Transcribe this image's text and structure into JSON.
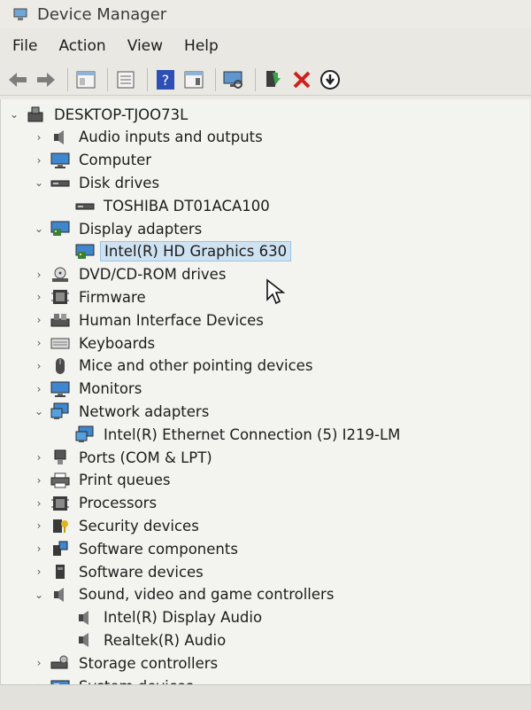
{
  "window": {
    "title": "Device Manager"
  },
  "menu": {
    "file": "File",
    "action": "Action",
    "view": "View",
    "help": "Help"
  },
  "toolbar": {
    "icons": [
      "back-arrow-icon",
      "forward-arrow-icon",
      "properties-icon",
      "list-icon",
      "help-icon",
      "view-icon",
      "scan-hardware-icon",
      "update-driver-icon",
      "uninstall-icon",
      "download-icon"
    ]
  },
  "tree": {
    "root": "DESKTOP-TJOO73L",
    "nodes": [
      {
        "label": "Audio inputs and outputs",
        "expanded": false
      },
      {
        "label": "Computer",
        "expanded": false
      },
      {
        "label": "Disk drives",
        "expanded": true
      },
      {
        "label": "TOSHIBA DT01ACA100",
        "child": true
      },
      {
        "label": "Display adapters",
        "expanded": true
      },
      {
        "label": "Intel(R) HD Graphics 630",
        "child": true,
        "selected": true
      },
      {
        "label": "DVD/CD-ROM drives",
        "expanded": false
      },
      {
        "label": "Firmware",
        "expanded": false
      },
      {
        "label": "Human Interface Devices",
        "expanded": false
      },
      {
        "label": "Keyboards",
        "expanded": false
      },
      {
        "label": "Mice and other pointing devices",
        "expanded": false
      },
      {
        "label": "Monitors",
        "expanded": false
      },
      {
        "label": "Network adapters",
        "expanded": true
      },
      {
        "label": "Intel(R) Ethernet Connection (5) I219-LM",
        "child": true
      },
      {
        "label": "Ports (COM & LPT)",
        "expanded": false
      },
      {
        "label": "Print queues",
        "expanded": false
      },
      {
        "label": "Processors",
        "expanded": false
      },
      {
        "label": "Security devices",
        "expanded": false
      },
      {
        "label": "Software components",
        "expanded": false
      },
      {
        "label": "Software devices",
        "expanded": false
      },
      {
        "label": "Sound, video and game controllers",
        "expanded": true
      },
      {
        "label": "Intel(R) Display Audio",
        "child": true
      },
      {
        "label": "Realtek(R) Audio",
        "child": true
      },
      {
        "label": "Storage controllers",
        "expanded": false
      },
      {
        "label": "System devices",
        "expanded": false
      }
    ]
  }
}
